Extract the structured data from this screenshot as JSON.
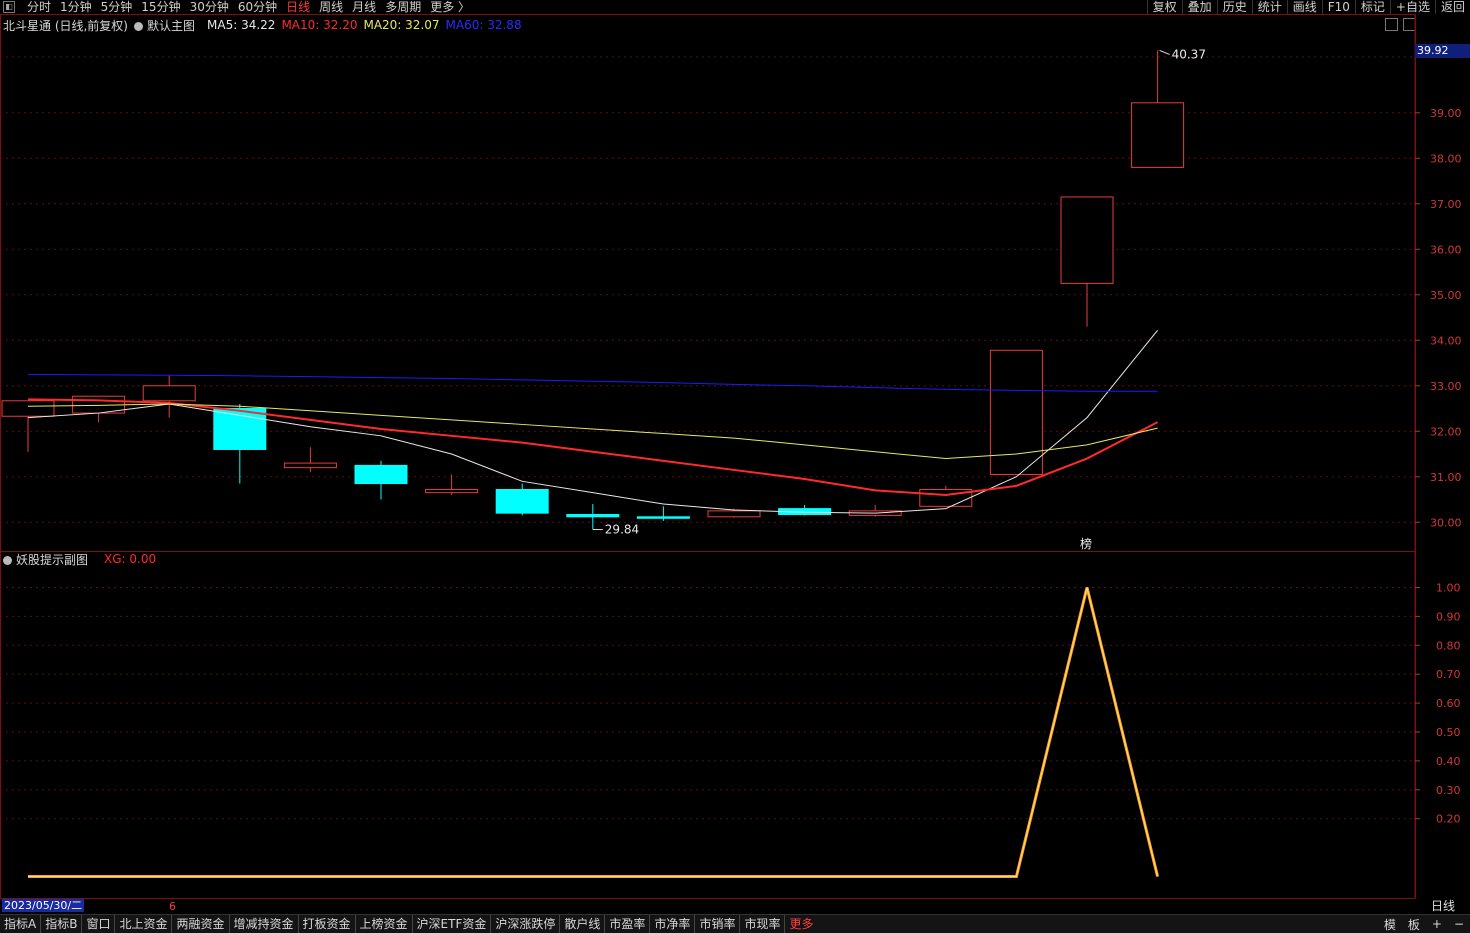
{
  "toolbar": {
    "periods": [
      "分时",
      "1分钟",
      "5分钟",
      "15分钟",
      "30分钟",
      "60分钟",
      "日线",
      "周线",
      "月线",
      "多周期",
      "更多 〉"
    ],
    "active_period": "日线",
    "right_buttons": [
      "复权",
      "叠加",
      "历史",
      "统计",
      "画线",
      "F10",
      "标记",
      "+自选",
      "返回"
    ]
  },
  "main_legend": {
    "stock": "北斗星通 (日线,前复权)",
    "template": "默认主图",
    "ma5": "MA5: 34.22",
    "ma10": "MA10: 32.20",
    "ma20": "MA20: 32.07",
    "ma60": "MA60: 32.88"
  },
  "sub_legend": {
    "title": "妖股提示副图",
    "xg": "XG: 0.00"
  },
  "price_tag": "39.92",
  "date_label": "2023/05/30/二",
  "month_marker": "6",
  "period_label": "日线",
  "annotations": {
    "high": "40.37",
    "low": "29.84",
    "signal": "榜"
  },
  "bottom_tabs": [
    "指标A",
    "指标B",
    "窗口",
    "北上资金",
    "两融资金",
    "增减持资金",
    "打板资金",
    "上榜资金",
    "沪深ETF资金",
    "沪深涨跌停",
    "散户线",
    "市盈率",
    "市净率",
    "市销率",
    "市现率",
    "更多"
  ],
  "bottom_right": [
    "模",
    "板",
    "+",
    "−"
  ],
  "colors": {
    "up": "#e83c3c",
    "down": "#00ffff",
    "ma5": "#e8e8e8",
    "ma10": "#ff2a2a",
    "ma20": "#e8e860",
    "ma60": "#1a1aff",
    "xg": "#ffa020",
    "grid": "#5a1010"
  },
  "chart_data": [
    {
      "type": "candlestick",
      "title": "北斗星通 (日线,前复权)",
      "y_ticks": [
        30.0,
        31.0,
        32.0,
        33.0,
        34.0,
        35.0,
        36.0,
        37.0,
        38.0,
        39.0
      ],
      "ylim": [
        29.5,
        40.6
      ],
      "candles": [
        {
          "open": 32.33,
          "close": 32.67,
          "high": 32.67,
          "low": 31.55
        },
        {
          "open": 32.4,
          "close": 32.77,
          "high": 32.77,
          "low": 32.2
        },
        {
          "open": 32.67,
          "close": 33.0,
          "high": 33.22,
          "low": 32.3
        },
        {
          "open": 32.5,
          "close": 31.6,
          "high": 32.6,
          "low": 30.85
        },
        {
          "open": 31.2,
          "close": 31.3,
          "high": 31.65,
          "low": 31.1
        },
        {
          "open": 31.25,
          "close": 30.85,
          "high": 31.35,
          "low": 30.5
        },
        {
          "open": 30.65,
          "close": 30.72,
          "high": 31.05,
          "low": 30.6
        },
        {
          "open": 30.72,
          "close": 30.2,
          "high": 30.85,
          "low": 30.15
        },
        {
          "open": 30.17,
          "close": 30.12,
          "high": 30.4,
          "low": 29.84
        },
        {
          "open": 30.12,
          "close": 30.09,
          "high": 30.35,
          "low": 30.03
        },
        {
          "open": 30.12,
          "close": 30.25,
          "high": 30.3,
          "low": 30.1
        },
        {
          "open": 30.3,
          "close": 30.17,
          "high": 30.38,
          "low": 30.15
        },
        {
          "open": 30.15,
          "close": 30.25,
          "high": 30.38,
          "low": 30.12
        },
        {
          "open": 30.35,
          "close": 30.72,
          "high": 30.8,
          "low": 30.35
        },
        {
          "open": 31.05,
          "close": 33.78,
          "high": 33.78,
          "low": 31.05
        },
        {
          "open": 35.25,
          "close": 37.15,
          "high": 37.15,
          "low": 34.3
        },
        {
          "open": 37.8,
          "close": 39.22,
          "high": 40.37,
          "low": 37.8
        }
      ],
      "series": [
        {
          "name": "MA5",
          "values": [
            32.3,
            32.4,
            32.6,
            32.35,
            32.1,
            31.9,
            31.5,
            30.9,
            30.65,
            30.4,
            30.27,
            30.22,
            30.2,
            30.3,
            31.0,
            32.3,
            34.22
          ]
        },
        {
          "name": "MA10",
          "values": [
            32.7,
            32.68,
            32.62,
            32.45,
            32.25,
            32.05,
            31.9,
            31.75,
            31.55,
            31.35,
            31.15,
            30.95,
            30.7,
            30.6,
            30.8,
            31.4,
            32.2
          ]
        },
        {
          "name": "MA20",
          "values": [
            32.55,
            32.57,
            32.6,
            32.55,
            32.45,
            32.35,
            32.25,
            32.15,
            32.05,
            31.95,
            31.85,
            31.7,
            31.55,
            31.4,
            31.5,
            31.7,
            32.07
          ]
        },
        {
          "name": "MA60",
          "values": [
            33.25,
            33.24,
            33.23,
            33.22,
            33.2,
            33.18,
            33.16,
            33.13,
            33.1,
            33.07,
            33.03,
            33.0,
            32.96,
            32.92,
            32.9,
            32.88,
            32.88
          ]
        }
      ]
    },
    {
      "type": "line",
      "title": "妖股提示副图",
      "y_ticks": [
        0.2,
        0.3,
        0.4,
        0.5,
        0.6,
        0.7,
        0.8,
        0.9,
        1.0
      ],
      "ylim": [
        -0.05,
        1.05
      ],
      "series": [
        {
          "name": "XG",
          "values": [
            0,
            0,
            0,
            0,
            0,
            0,
            0,
            0,
            0,
            0,
            0,
            0,
            0,
            0,
            0,
            1,
            0
          ]
        }
      ]
    }
  ]
}
